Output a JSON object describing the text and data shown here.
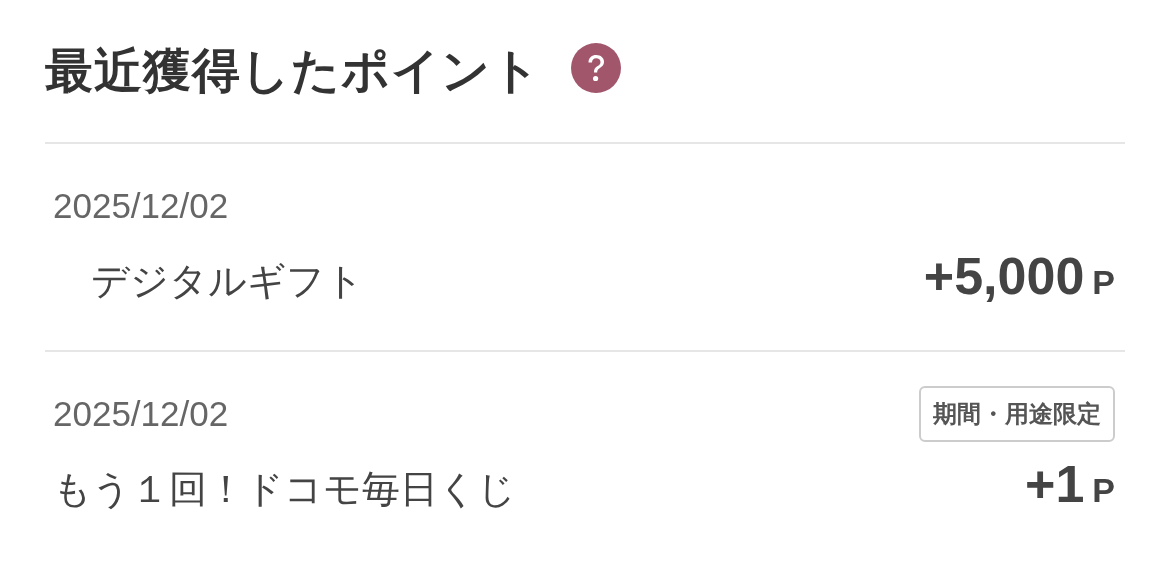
{
  "title": "最近獲得したポイント",
  "entries": [
    {
      "date": "2025/12/02",
      "name": "　デジタルギフト",
      "amount": "+5,000",
      "unit": "P"
    },
    {
      "date": "2025/12/02",
      "badge": "期間・用途限定",
      "name": "もう１回！ドコモ毎日くじ",
      "amount": "+1",
      "unit": "P"
    }
  ]
}
